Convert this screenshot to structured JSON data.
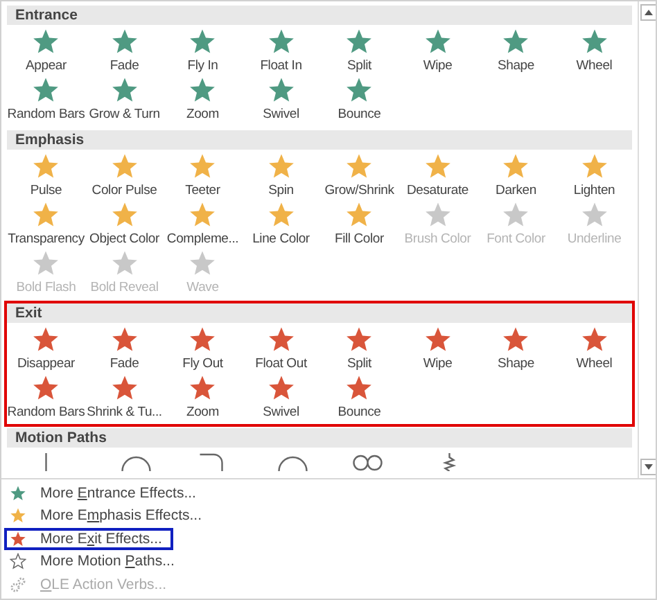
{
  "sections": [
    {
      "title": "Entrance",
      "kind": "entrance",
      "highlighted": false,
      "items": [
        {
          "label": "Appear",
          "disabled": false
        },
        {
          "label": "Fade",
          "disabled": false
        },
        {
          "label": "Fly In",
          "disabled": false
        },
        {
          "label": "Float In",
          "disabled": false
        },
        {
          "label": "Split",
          "disabled": false
        },
        {
          "label": "Wipe",
          "disabled": false
        },
        {
          "label": "Shape",
          "disabled": false
        },
        {
          "label": "Wheel",
          "disabled": false
        },
        {
          "label": "Random Bars",
          "disabled": false
        },
        {
          "label": "Grow & Turn",
          "disabled": false
        },
        {
          "label": "Zoom",
          "disabled": false
        },
        {
          "label": "Swivel",
          "disabled": false
        },
        {
          "label": "Bounce",
          "disabled": false
        }
      ]
    },
    {
      "title": "Emphasis",
      "kind": "emphasis",
      "highlighted": false,
      "items": [
        {
          "label": "Pulse",
          "disabled": false
        },
        {
          "label": "Color Pulse",
          "disabled": false
        },
        {
          "label": "Teeter",
          "disabled": false
        },
        {
          "label": "Spin",
          "disabled": false
        },
        {
          "label": "Grow/Shrink",
          "disabled": false
        },
        {
          "label": "Desaturate",
          "disabled": false
        },
        {
          "label": "Darken",
          "disabled": false
        },
        {
          "label": "Lighten",
          "disabled": false
        },
        {
          "label": "Transparency",
          "disabled": false
        },
        {
          "label": "Object Color",
          "disabled": false
        },
        {
          "label": "Compleme...",
          "disabled": false
        },
        {
          "label": "Line Color",
          "disabled": false
        },
        {
          "label": "Fill Color",
          "disabled": false
        },
        {
          "label": "Brush Color",
          "disabled": true
        },
        {
          "label": "Font Color",
          "disabled": true
        },
        {
          "label": "Underline",
          "disabled": true
        },
        {
          "label": "Bold Flash",
          "disabled": true
        },
        {
          "label": "Bold Reveal",
          "disabled": true
        },
        {
          "label": "Wave",
          "disabled": true
        }
      ]
    },
    {
      "title": "Exit",
      "kind": "exit",
      "highlighted": true,
      "items": [
        {
          "label": "Disappear",
          "disabled": false
        },
        {
          "label": "Fade",
          "disabled": false
        },
        {
          "label": "Fly Out",
          "disabled": false
        },
        {
          "label": "Float Out",
          "disabled": false
        },
        {
          "label": "Split",
          "disabled": false
        },
        {
          "label": "Wipe",
          "disabled": false
        },
        {
          "label": "Shape",
          "disabled": false
        },
        {
          "label": "Wheel",
          "disabled": false
        },
        {
          "label": "Random Bars",
          "disabled": false
        },
        {
          "label": "Shrink & Tu...",
          "disabled": false
        },
        {
          "label": "Zoom",
          "disabled": false
        },
        {
          "label": "Swivel",
          "disabled": false
        },
        {
          "label": "Bounce",
          "disabled": false
        }
      ]
    },
    {
      "title": "Motion Paths",
      "kind": "motion",
      "highlighted": false
    }
  ],
  "menu": [
    {
      "kind": "entrance",
      "before": "More ",
      "key": "E",
      "after": "ntrance Effects...",
      "highlighted": false,
      "disabled": false
    },
    {
      "kind": "emphasis",
      "before": "More E",
      "key": "m",
      "after": "phasis Effects...",
      "highlighted": false,
      "disabled": false
    },
    {
      "kind": "exit",
      "before": "More E",
      "key": "x",
      "after": "it Effects...",
      "highlighted": true,
      "disabled": false
    },
    {
      "kind": "motion",
      "before": "More Motion ",
      "key": "P",
      "after": "aths...",
      "highlighted": false,
      "disabled": false
    },
    {
      "kind": "ole",
      "key": "O",
      "after": "LE Action Verbs...",
      "highlighted": false,
      "disabled": true
    }
  ]
}
